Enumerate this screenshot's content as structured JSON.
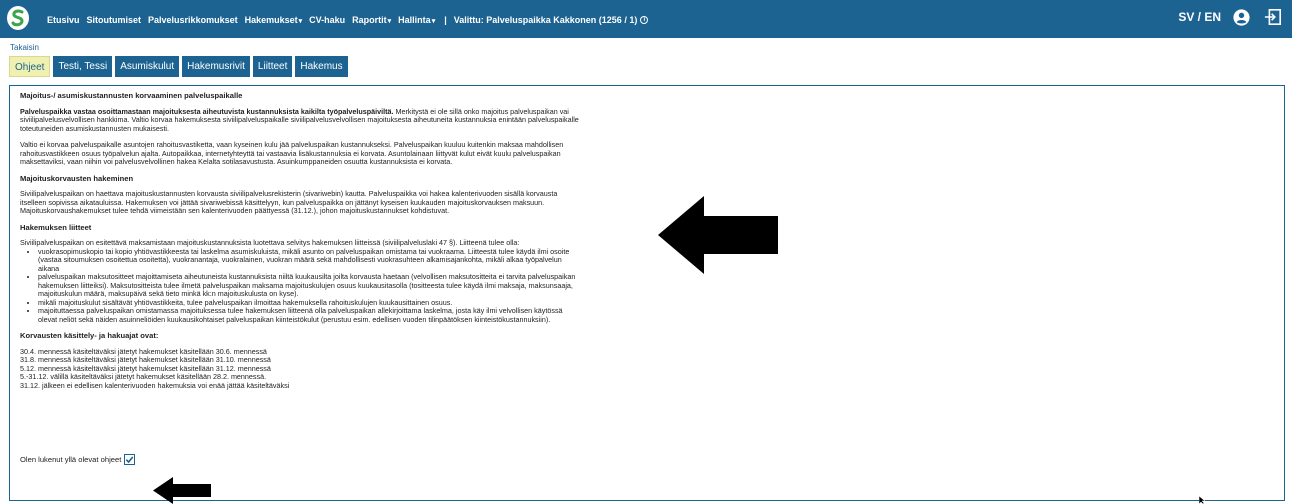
{
  "topbar": {
    "nav_items": [
      {
        "label": "Etusivu",
        "caret": false
      },
      {
        "label": "Sitoutumiset",
        "caret": false
      },
      {
        "label": "Palvelusrikkomukset",
        "caret": false
      },
      {
        "label": "Hakemukset",
        "caret": true
      },
      {
        "label": "CV-haku",
        "caret": false
      },
      {
        "label": "Raportit",
        "caret": true
      },
      {
        "label": "Hallinta",
        "caret": true
      }
    ],
    "separator": "|",
    "selected_label": "Valittu: Palveluspaikka Kakkonen (1256 / 1)",
    "info_glyph": "i",
    "language": "SV / EN",
    "caret_glyph": "▾"
  },
  "back_link": "Takaisin",
  "tabs": [
    "Ohjeet",
    "Testi, Tessi",
    "Asumiskulut",
    "Hakemusrivit",
    "Liitteet",
    "Hakemus"
  ],
  "content": {
    "heading1": "Majoitus-/ asumiskustannusten korvaaminen palveluspaikalle",
    "p1_bold": "Palveluspaikka vastaa osoittamastaan majoituksesta aiheutuvista kustannuksista kaikilta työpalveluspäiviltä.",
    "p1_rest": " Merkitystä ei ole sillä onko majoitus palveluspaikan vai siviilipalvelusvelvollisen hankkima. Valtio korvaa hakemuksesta siviilipalveluspaikalle siviilipalvelusvelvollisen majoituksesta aiheutuneita kustannuksia enintään palveluspaikalle toteutuneiden asumiskustannusten mukaisesti.",
    "p2": "Valtio ei korvaa palveluspaikalle asuntojen rahoitusvastiketta, vaan kyseinen kulu jää palveluspaikan kustannukseksi. Palveluspaikan kuuluu kuitenkin maksaa mahdollisen rahoitusvastikkeen osuus työpalvelun ajalta. Autopaikkaa, internetyhteyttä tai vastaavia lisäkustannuksia ei korvata. Asuntolainaan liittyvät kulut eivät kuulu palveluspaikan maksettaviksi, vaan niihin voi palvelusvelvollinen hakea Kelalta sotilasavustusta. Asuinkumppaneiden osuutta kustannuksista ei korvata.",
    "heading2": "Majoituskorvausten hakeminen",
    "p3": "Siviilipalveluspaikan on haettava majoituskustannusten korvausta siviilipalvelusrekisterin (sivariwebin) kautta. Palveluspaikka voi hakea kalenterivuoden sisällä korvausta itselleen sopivissa aikatauluissa. Hakemuksen voi jättää sivariwebissä käsittelyyn, kun palveluspaikka on jättänyt kyseisen kuukauden majoituskorvauksen maksuun. Majoituskorvaushakemukset tulee tehdä viimeistään sen kalenterivuoden päättyessä (31.12.), johon majoituskustannukset kohdistuvat.",
    "heading3": "Hakemuksen liitteet",
    "p4": "Siviilipalveluspaikan on esitettävä maksamistaan majoituskustannuksista luotettava selvitys hakemuksen liitteissä (siviilipalveluslaki 47 §). Liitteenä tulee olla:",
    "bullets": [
      "vuokrasopimuskopio tai kopio yhtiövastikkeesta tai laskelma asumiskuluista, mikäli asunto on palveluspaikan omistama tai vuokraama. Liitteestä tulee käydä ilmi osoite (vastaa sitoumuksen osoitettua osoitetta), vuokranantaja, vuokralainen, vuokran määrä sekä mahdollisesti vuokrasuhteen alkamisajankohta, mikäli alkaa työpalvelun aikana",
      "palveluspaikan maksutositteet majoittamiseta aiheutuneista kustannuksista niiltä kuukausilta joilta korvausta haetaan (velvollisen maksutositteita ei tarvita palveluspaikan hakemuksen liitteiksi). Maksutositteista tulee ilmetä palveluspaikan maksama majoituskulujen osuus kuukausitasolla (tositteesta tulee käydä ilmi maksaja, maksunsaaja, majoituskulun määrä, maksupäivä sekä tieto minkä kk:n majoituskulusta on kyse).",
      "mikäli majoituskulut sisältävät yhtiövastikkeita, tulee palveluspaikan ilmoittaa hakemuksella rahoituskulujen kuukausittainen osuus.",
      "majoituttaessa palveluspaikan omistamassa majoituksessa tulee hakemuksen liitteenä olla palveluspaikan allekirjoittama laskelma, josta käy ilmi velvollisen käytössä olevat neliöt sekä näiden asuinneliöiden kuukausikohtaiset palveluspaikan kiinteistökulut (perustuu esim. edellisen vuoden tilinpäätöksen kiinteistökustannuksiin)."
    ],
    "heading4": "Korvausten käsittely- ja hakuajat ovat:",
    "schedule": [
      "30.4. mennessä käsiteltäväksi jätetyt hakemukset käsitellään 30.6. mennessä",
      "31.8. mennessä käsiteltäväksi jätetyt hakemukset käsitellään 31.10. mennessä",
      "5.12. mennessä käsiteltäväksi jätetyt hakemukset käsitellään 31.12. mennessä",
      "5.-31.12. välillä käsiteltäväksi jätetyt hakemukset käsitellään 28.2. mennessä.",
      "31.12. jälkeen ei edellisen kalenterivuoden hakemuksia voi enää jättää käsiteltäväksi"
    ],
    "ack_label": "Olen lukenut yllä olevat ohjeet",
    "ack_checked": true
  },
  "colors": {
    "primary": "#1d6392",
    "active_tab": "#f0f0b0",
    "annotation_arrow": "#000000"
  }
}
